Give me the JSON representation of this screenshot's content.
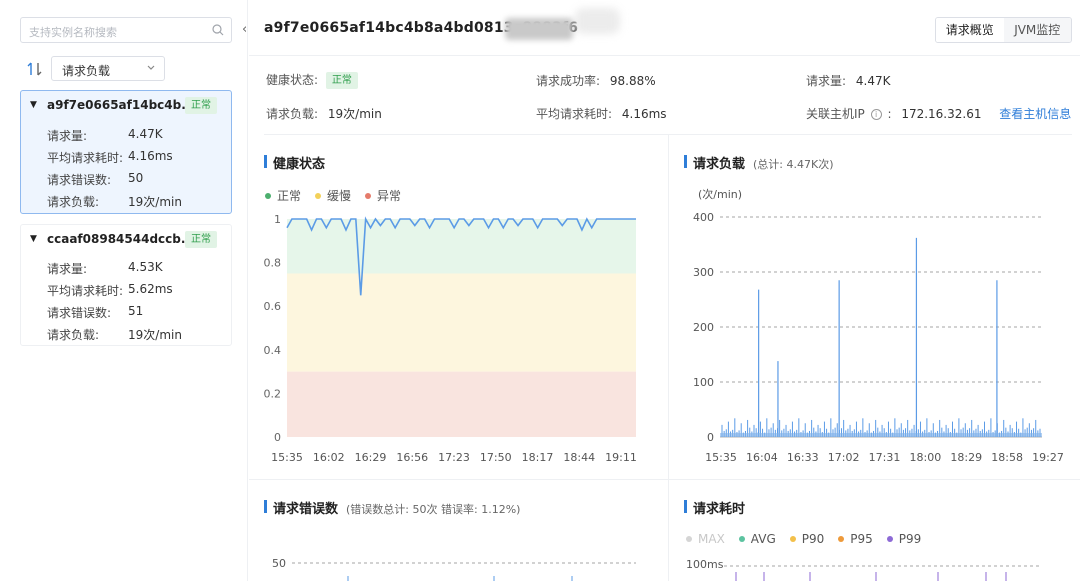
{
  "sidebar": {
    "search_placeholder": "支持实例名称搜索",
    "sort_select": "请求负载",
    "collapse_icon": "chevron-left-icon",
    "instances": [
      {
        "name": "a9f7e0665af14bc4b...",
        "status": "正常",
        "selected": true,
        "metrics": [
          {
            "label": "请求量:",
            "value": "4.47K"
          },
          {
            "label": "平均请求耗时:",
            "value": "4.16ms"
          },
          {
            "label": "请求错误数:",
            "value": "50"
          },
          {
            "label": "请求负载:",
            "value": "19次/min"
          }
        ]
      },
      {
        "name": "ccaaf08984544dccb...",
        "status": "正常",
        "selected": false,
        "metrics": [
          {
            "label": "请求量:",
            "value": "4.53K"
          },
          {
            "label": "平均请求耗时:",
            "value": "5.62ms"
          },
          {
            "label": "请求错误数:",
            "value": "51"
          },
          {
            "label": "请求负载:",
            "value": "19次/min"
          }
        ]
      }
    ]
  },
  "header": {
    "title": "a9f7e0665af14bc4b8a4bd0813c8883f6",
    "tabs": [
      "请求概览",
      "JVM监控"
    ],
    "active_tab": 0
  },
  "info": {
    "health_label": "健康状态:",
    "health_value": "正常",
    "success_label": "请求成功率:",
    "success_value": "98.88%",
    "count_label": "请求量:",
    "count_value": "4.47K",
    "load_label": "请求负载:",
    "load_value": "19次/min",
    "latency_label": "平均请求耗时:",
    "latency_value": "4.16ms",
    "host_label": "关联主机IP",
    "host_value": "172.16.32.61",
    "host_link": "查看主机信息"
  },
  "panels": {
    "health": {
      "title": "健康状态",
      "legend": [
        "正常",
        "缓慢",
        "异常"
      ]
    },
    "load": {
      "title": "请求负载",
      "sub": "(总计: 4.47K次)",
      "unit": "(次/min)"
    },
    "errors": {
      "title": "请求错误数",
      "sub": "(错误数总计: 50次   错误率: 1.12%)"
    },
    "latency": {
      "title": "请求耗时",
      "legend": [
        "MAX",
        "AVG",
        "P90",
        "P95",
        "P99"
      ]
    }
  },
  "colors": {
    "accent": "#2f7ed8",
    "normal": "#4caf6e",
    "slow": "#f3d15a",
    "abnormal": "#e57b6b",
    "line": "#5b9be6"
  },
  "chart_data": [
    {
      "type": "line",
      "title": "健康状态",
      "x": [
        "15:35",
        "16:02",
        "16:29",
        "16:56",
        "17:23",
        "17:50",
        "18:17",
        "18:44",
        "19:11"
      ],
      "ylim": [
        0,
        1
      ],
      "yticks": [
        "0",
        "0.2",
        "0.4",
        "0.6",
        "0.8",
        "1"
      ],
      "bands": [
        {
          "name": "异常",
          "from": 0,
          "to": 0.3
        },
        {
          "name": "缓慢",
          "from": 0.3,
          "to": 0.75
        },
        {
          "name": "正常",
          "from": 0.75,
          "to": 1
        }
      ],
      "series": [
        {
          "name": "正常",
          "values": [
            0.96,
            1,
            1,
            1,
            1,
            0.95,
            1,
            1,
            0.96,
            1,
            1,
            1,
            0.95,
            1,
            1,
            0.65,
            1,
            0.96,
            1,
            0.97,
            1,
            1,
            0.96,
            1,
            1,
            1,
            0.97,
            1,
            1,
            0.96,
            1,
            1,
            1,
            1,
            0.96,
            1,
            1,
            0.97,
            1,
            1,
            1,
            0.96,
            1,
            1,
            0.96,
            1,
            1,
            0.97,
            1,
            1,
            1,
            0.96,
            1,
            1,
            1,
            1,
            0.97,
            1,
            1,
            1,
            0.95,
            1,
            0.96,
            1,
            1,
            1,
            1,
            1,
            1,
            1,
            1,
            1
          ]
        }
      ]
    },
    {
      "type": "bar",
      "title": "请求负载",
      "x": [
        "15:35",
        "16:04",
        "16:33",
        "17:02",
        "17:31",
        "18:00",
        "18:29",
        "18:58",
        "19:27"
      ],
      "ylim": [
        0,
        400
      ],
      "yticks": [
        "0",
        "100",
        "200",
        "300",
        "400"
      ],
      "ylabel": "(次/min)",
      "spikes": [
        {
          "pos": 0.12,
          "value": 268
        },
        {
          "pos": 0.18,
          "value": 138
        },
        {
          "pos": 0.37,
          "value": 285
        },
        {
          "pos": 0.61,
          "value": 362
        },
        {
          "pos": 0.86,
          "value": 285
        }
      ]
    },
    {
      "type": "line",
      "title": "请求错误数",
      "yticks": [
        "50"
      ]
    },
    {
      "type": "line",
      "title": "请求耗时",
      "yticks": [
        "100ms"
      ]
    }
  ]
}
